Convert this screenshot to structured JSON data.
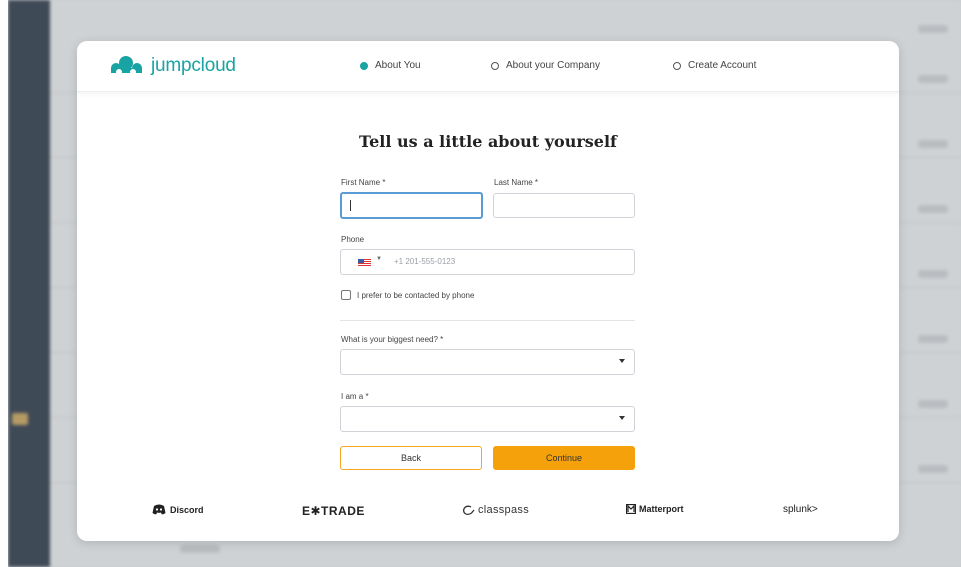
{
  "header": {
    "logo_text": "jumpcloud",
    "steps": [
      {
        "label": "About You",
        "active": true
      },
      {
        "label": "About your Company",
        "active": false
      },
      {
        "label": "Create Account",
        "active": false
      }
    ]
  },
  "form": {
    "title": "Tell us a little about yourself",
    "first_name_label": "First Name *",
    "first_name_value": "",
    "last_name_label": "Last Name *",
    "last_name_value": "",
    "phone_label": "Phone",
    "phone_placeholder": "+1 201-555-0123",
    "phone_country_icon": "us-flag-icon",
    "contact_by_phone_label": "I prefer to be contacted by phone",
    "contact_by_phone_checked": false,
    "biggest_need_label": "What is your biggest need? *",
    "biggest_need_value": "",
    "i_am_a_label": "I am a *",
    "i_am_a_value": "",
    "back_label": "Back",
    "continue_label": "Continue"
  },
  "brands": {
    "discord": "Discord",
    "etrade": "E✱TRADE",
    "classpass": "classpass",
    "matterport": "Matterport",
    "splunk": "splunk>"
  },
  "colors": {
    "accent_teal": "#1aa3a3",
    "continue_orange": "#f5a10c",
    "focus_blue": "#5b9bd5"
  }
}
